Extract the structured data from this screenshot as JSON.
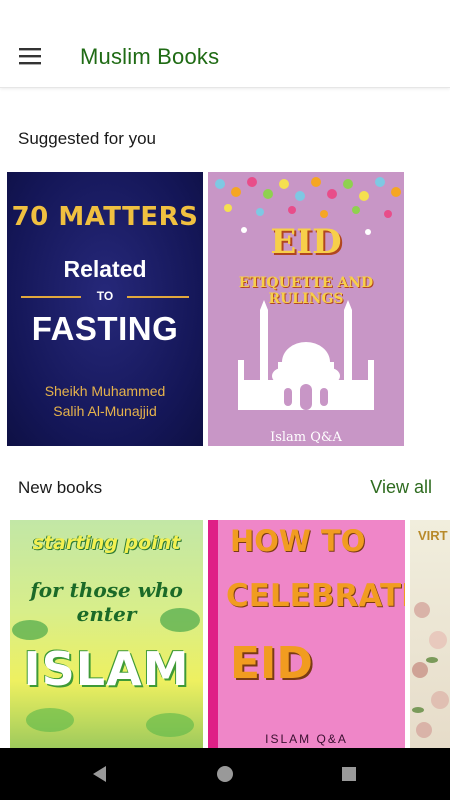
{
  "app_bar": {
    "menu_icon": "hamburger-menu-icon",
    "title": "Muslim Books",
    "title_color": "#1f6b14"
  },
  "sections": {
    "suggested": {
      "title": "Suggested for you"
    },
    "new_books": {
      "title": "New books",
      "view_all": "View all",
      "view_all_color": "#2e6b1f"
    }
  },
  "suggested_books": [
    {
      "cover_line1": "70 MATTERS",
      "cover_line2": "Related",
      "cover_line3": "TO",
      "cover_line4": "FASTING",
      "author_line1": "Sheikh Muhammed",
      "author_line2": "Salih Al-Munajjid",
      "accent": "#f0c040",
      "background": "#141657"
    },
    {
      "cover_line1": "EID",
      "cover_line2": "ETIQUETTE AND RULINGS",
      "publisher": "Islam Q&A",
      "accent": "#f7cf4a",
      "background": "#c896c6"
    }
  ],
  "new_books": [
    {
      "cover_line1": "starting point",
      "cover_line2": "for those who enter",
      "cover_line3": "ISLAM",
      "background": "#d8ee8a"
    },
    {
      "cover_line1": "HOW TO",
      "cover_line2": "CELEBRATE",
      "cover_line3": "EID",
      "publisher": "ISLAM Q&A",
      "background": "#df1f86"
    },
    {
      "cover_line1": "VIRT",
      "background": "#e6dcc9"
    }
  ],
  "system_nav": {
    "back_icon": "back-triangle-icon",
    "home_icon": "home-circle-icon",
    "recents_icon": "recents-square-icon"
  }
}
